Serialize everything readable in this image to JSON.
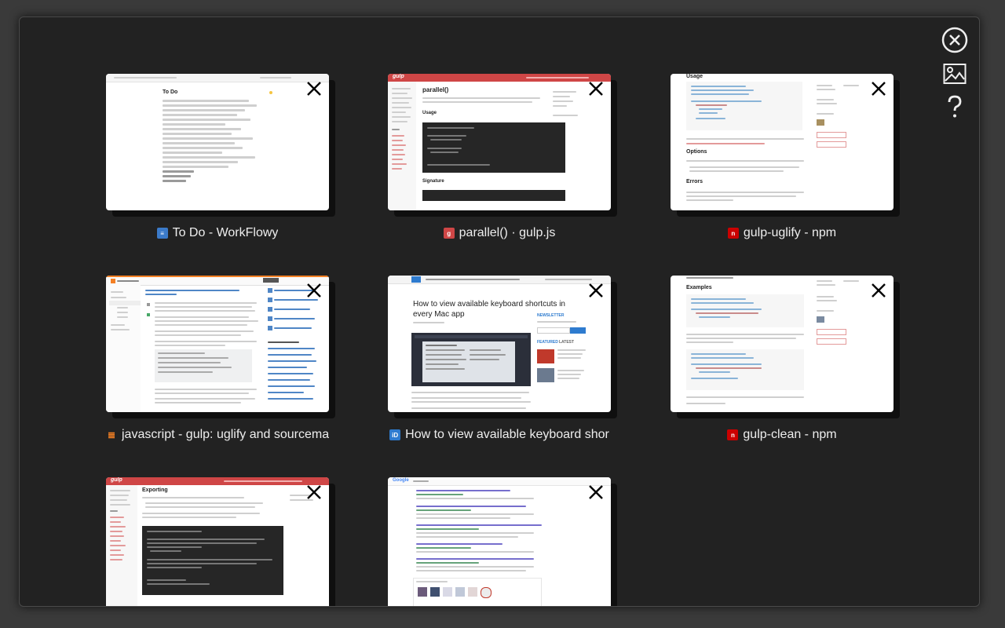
{
  "tabs": [
    {
      "title": "To Do - WorkFlowy",
      "favicon": "workflowy-icon",
      "favicon_color": "#3b7ac9"
    },
    {
      "title": "parallel() · gulp.js",
      "favicon": "gulp-icon",
      "favicon_color": "#cf4646"
    },
    {
      "title": "gulp-uglify - npm",
      "favicon": "npm-icon",
      "favicon_color": "#cb0000"
    },
    {
      "title": "javascript - gulp: uglify and sourcema",
      "favicon": "stackoverflow-icon",
      "favicon_color": "#f48024"
    },
    {
      "title": "How to view available keyboard shor",
      "favicon": "idb-icon",
      "favicon_color": "#2e7bcf"
    },
    {
      "title": "gulp-clean - npm",
      "favicon": "npm-icon",
      "favicon_color": "#cb0000"
    },
    {
      "title": "",
      "favicon": "gulp-icon",
      "favicon_color": "#cf4646"
    },
    {
      "title": "",
      "favicon": "google-icon",
      "favicon_color": "#4285f4"
    }
  ],
  "thumbs": {
    "t0_heading": "To Do",
    "t1_heading": "parallel()",
    "t1_sub1": "Usage",
    "t1_sub2": "Signature",
    "t2_heading": "Usage",
    "t2_sub1": "Options",
    "t2_sub2": "Errors",
    "t3_heading": "Examples",
    "t4_heading": "How to view available keyboard shortcuts in every Mac app",
    "t4_news": "NEWSLETTER",
    "t4_featured": "FEATURED",
    "t4_latest": "LATEST",
    "t5_heading": "Exporting",
    "t6_brand": "Google",
    "t7_brand": "gulp"
  }
}
